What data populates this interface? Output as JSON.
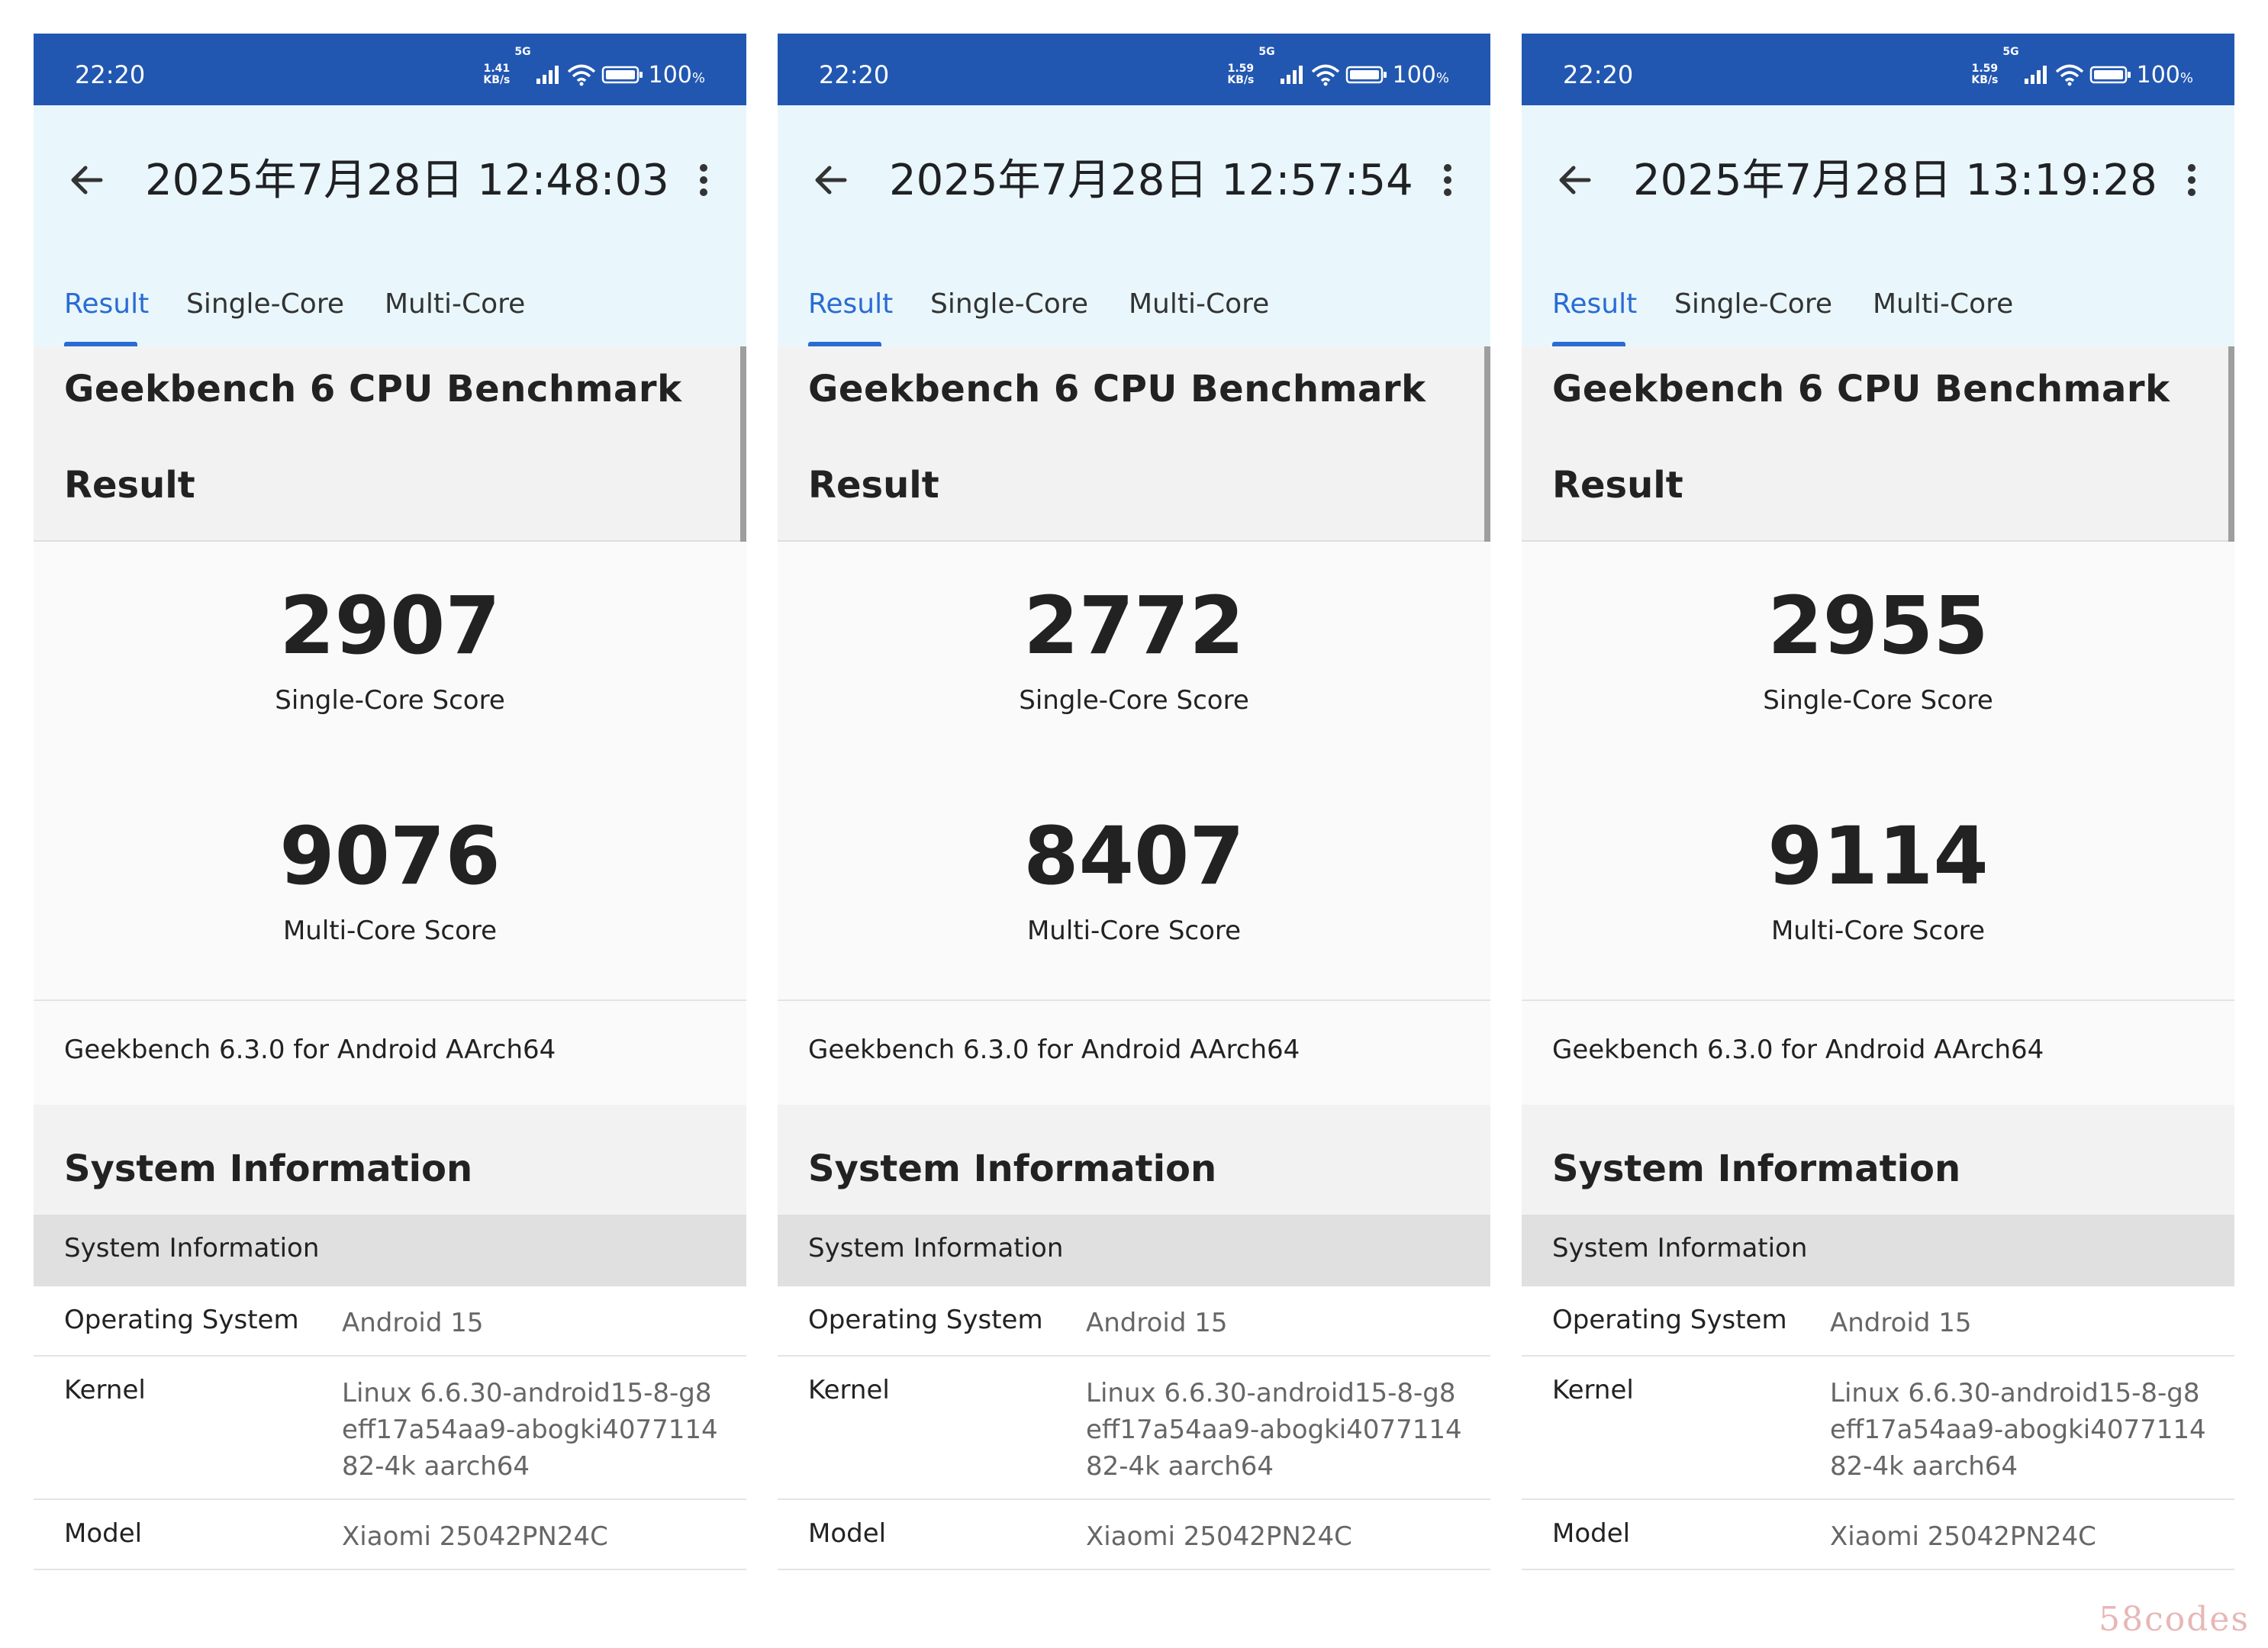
{
  "status_bar": {
    "time": "22:20",
    "network_type": "5G",
    "battery_percent": "100",
    "battery_unit": "%"
  },
  "tabs": [
    "Result",
    "Single-Core",
    "Multi-Core"
  ],
  "benchmark_title": "Geekbench 6 CPU Benchmark",
  "result_heading": "Result",
  "single_core_label": "Single-Core Score",
  "multi_core_label": "Multi-Core Score",
  "version_text": "Geekbench 6.3.0 for Android AArch64",
  "system_info_title": "System Information",
  "system_info_subheader": "System Information",
  "system_info_rows": [
    {
      "key": "Operating System",
      "value": "Android 15"
    },
    {
      "key": "Kernel",
      "value": "Linux 6.6.30-android15-8-g8eff17a54aa9-abogki407711482-4k aarch64"
    },
    {
      "key": "Model",
      "value": "Xiaomi 25042PN24C"
    }
  ],
  "panels": [
    {
      "title": "2025年7月28日 12:48:03",
      "net_speed_value": "1.41",
      "net_speed_unit": "KB/s",
      "single_core_score": "2907",
      "multi_core_score": "9076"
    },
    {
      "title": "2025年7月28日 12:57:54",
      "net_speed_value": "1.59",
      "net_speed_unit": "KB/s",
      "single_core_score": "2772",
      "multi_core_score": "8407"
    },
    {
      "title": "2025年7月28日 13:19:28",
      "net_speed_value": "1.59",
      "net_speed_unit": "KB/s",
      "single_core_score": "2955",
      "multi_core_score": "9114"
    }
  ],
  "colors": {
    "status_bar": "#2257b1",
    "app_bar": "#e9f7fc",
    "accent": "#2a6bd4"
  },
  "watermark": "58codes"
}
